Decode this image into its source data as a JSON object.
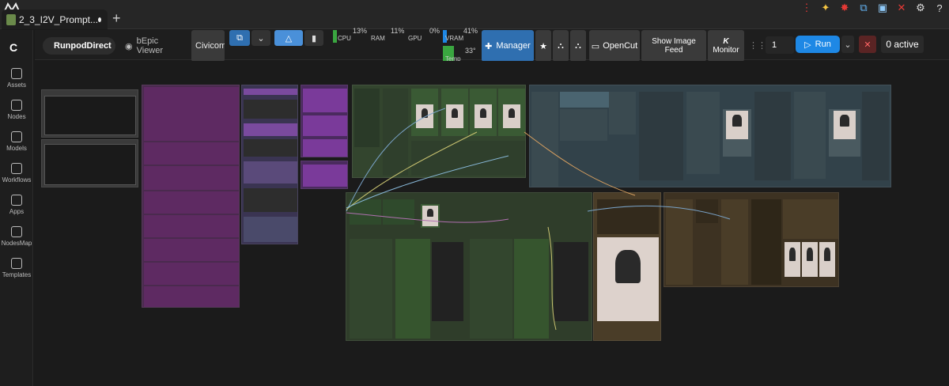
{
  "tab": {
    "title": "2_3_I2V_Prompt..."
  },
  "sidebar": {
    "items": [
      {
        "label": "Assets"
      },
      {
        "label": "Nodes"
      },
      {
        "label": "Models"
      },
      {
        "label": "Workflows"
      },
      {
        "label": "Apps"
      },
      {
        "label": "NodesMap"
      },
      {
        "label": "Templates"
      }
    ]
  },
  "toolbar": {
    "runpod": "RunpodDirect",
    "viewer": "bEpic Viewer",
    "civicomf": "Civicomf",
    "cpu_label": "CPU",
    "cpu": "13%",
    "ram_label": "RAM",
    "ram": "11%",
    "gpu_label": "GPU",
    "gpu": "0%",
    "vram_label": "VRAM",
    "vram": "41%",
    "temp_label": "Temp",
    "temp": "33°",
    "manager": "Manager",
    "opencut": "OpenCut",
    "show_image_feed_1": "Show Image",
    "show_image_feed_2": "Feed",
    "monitor": "Monitor",
    "monitor_k": "K",
    "queue_count": "1",
    "run": "Run",
    "active": "0 active"
  },
  "colors": {
    "accent": "#1e88e5",
    "run": "#1e88e5",
    "manager": "#2f6fb0",
    "purple_group": "#5a2a5e",
    "green_group": "#2f3d2a",
    "blue_group": "#2d3a42",
    "brown_group": "#3d3222"
  },
  "icons": [
    "logo-icon",
    "close-dot-icon",
    "plus-icon",
    "star-icon",
    "puzzle-icon",
    "run-play-icon",
    "stop-icon",
    "chevron-down-icon",
    "settings-icon",
    "help-icon"
  ]
}
